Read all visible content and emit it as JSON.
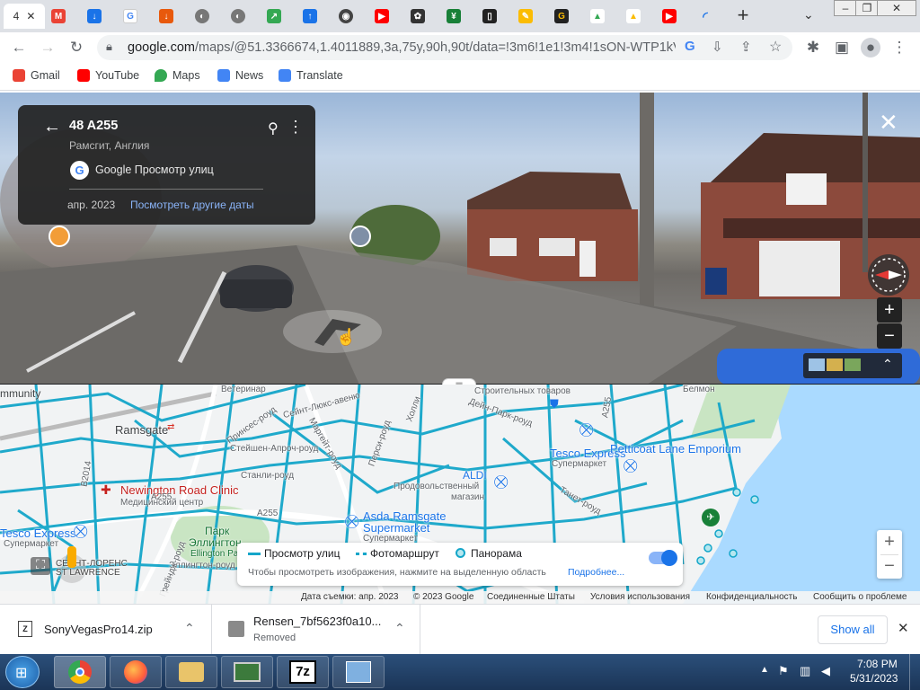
{
  "browser": {
    "active_tab_label": "4",
    "new_tab": "+",
    "url_domain": "google.com",
    "url_path": "/maps/@51.3366674,1.4011889,3a,75y,90h,90t/data=!3m6!1e1!3m4!1sON-WTP1kVy..."
  },
  "bookmarks": [
    {
      "label": "Gmail",
      "color": "#ea4335"
    },
    {
      "label": "YouTube",
      "color": "#ff0000"
    },
    {
      "label": "Maps",
      "color": "#34a853"
    },
    {
      "label": "News",
      "color": "#4285f4"
    },
    {
      "label": "Translate",
      "color": "#4285f4"
    }
  ],
  "streetview": {
    "title": "48 A255",
    "subtitle": "Рамсгит, Англия",
    "provider": "Google Просмотр улиц",
    "date": "апр. 2023",
    "other_dates": "Посмотреть другие даты"
  },
  "map": {
    "labels": {
      "ramsgate": "Ramsgate",
      "newington": "Newington Road Clinic",
      "newington_sub": "Медицинский центр",
      "tesco_sm": "Tesco Express",
      "tesco_sm_sub": "Супермаркет",
      "tesco": "Tesco Express",
      "tesco_sub": "Супермаркет",
      "petticoat": "Petticoat Lane Emporium",
      "aldi": "ALDI",
      "aldi_sub1": "Продовольственный",
      "aldi_sub2": "магазин",
      "asda1": "Asda Ramsgate",
      "asda2": "Supermarket",
      "asda_sub": "Супермаркет",
      "park1": "Парк",
      "park2": "Эллингтон",
      "park3": "Ellington Park",
      "a255_a": "A255",
      "a255_b": "A255",
      "b2014": "B2014",
      "st_lawrence1": "СЕЙНТ-ЛОРЕНС",
      "st_lawrence2": "ST LAWRENCE",
      "margate_road": "Маргейт-роуд",
      "princes": "Принсес-роуд",
      "stanley": "Станли-роуд",
      "staleyapr": "Стейшен-Апроч-роуд",
      "ellington_rd": "Эллингтон-роуд",
      "saint_lukes": "Сейнт-Люкс-авеню",
      "dane_park": "Дейн-Парк-роуд",
      "pearse": "Перси-роуд",
      "community": "mmunity",
      "veterin": "Ветеринар",
      "trade": "Строительных товаров",
      "holly": "Холли",
      "grange": "Грейндж-роуд",
      "a255_c": "A255",
      "tanet": "Танет-роуд",
      "belmont": "Белмон"
    },
    "legend": {
      "streets": "Просмотр улиц",
      "photo": "Фотомаршрут",
      "pano": "Панорама",
      "hint": "Чтобы просмотреть изображения, нажмите на выделенную область",
      "more": "Подробнее..."
    },
    "footer": {
      "date": "Дата съемки: апр. 2023",
      "copyright": "© 2023 Google",
      "country": "Соединенные Штаты",
      "terms": "Условия использования",
      "privacy": "Конфиденциальность",
      "report": "Сообщить о проблеме"
    }
  },
  "downloads": {
    "item1": {
      "name": "SonyVegasPro14.zip",
      "status": ""
    },
    "item2": {
      "name": "Rensen_7bf5623f0a10...",
      "status": "Removed"
    },
    "show_all": "Show all"
  },
  "taskbar": {
    "time": "7:08 PM",
    "date": "5/31/2023",
    "seven_zip": "7z"
  },
  "colors": {
    "streetview_line": "#14a6c9",
    "map_bg": "#f1f3f4",
    "water": "#aadaff",
    "park": "#c9e5c3",
    "accent": "#1a73e8"
  }
}
